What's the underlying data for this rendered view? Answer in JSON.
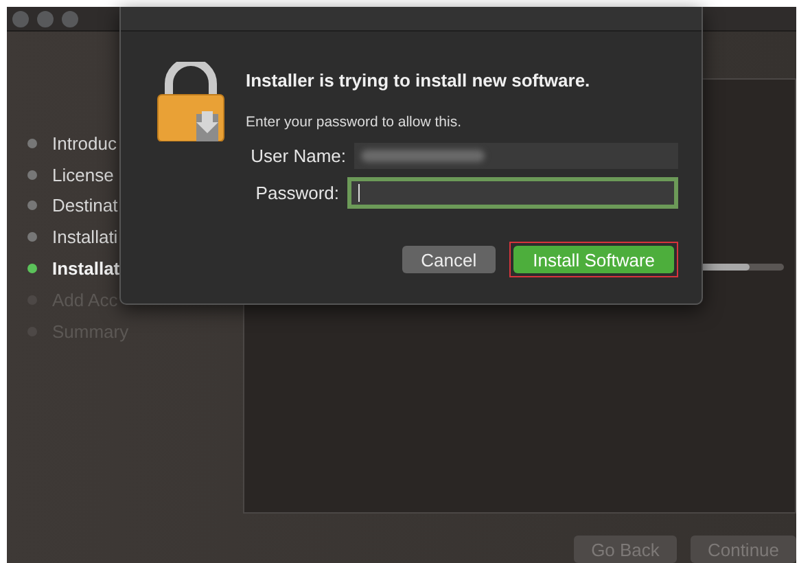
{
  "progress": {
    "level": 0.93
  },
  "sidebar": {
    "items": [
      {
        "label": "Introduc",
        "kind": "done"
      },
      {
        "label": "License",
        "kind": "done"
      },
      {
        "label": "Destinat",
        "kind": "done"
      },
      {
        "label": "Installati",
        "kind": "done"
      },
      {
        "label": "Installat",
        "kind": "current"
      },
      {
        "label": "Add Acc",
        "kind": "pending"
      },
      {
        "label": "Summary",
        "kind": "pending"
      }
    ]
  },
  "footer": {
    "buttons": [
      {
        "label": "Go Back",
        "disabled": true
      },
      {
        "label": "Continue",
        "disabled": true
      }
    ]
  },
  "dialog": {
    "title": "Installer is trying to install new software.",
    "message": "Enter your password to allow this.",
    "fields": [
      {
        "label": "User Name:",
        "kind": "blurred",
        "focused": false
      },
      {
        "label": "Password:",
        "kind": "password",
        "focused": true
      }
    ],
    "buttons": [
      {
        "label": "Cancel",
        "kind": "secondary",
        "highlighted": false
      },
      {
        "label": "Install Software",
        "kind": "primary",
        "highlighted": true
      }
    ]
  }
}
